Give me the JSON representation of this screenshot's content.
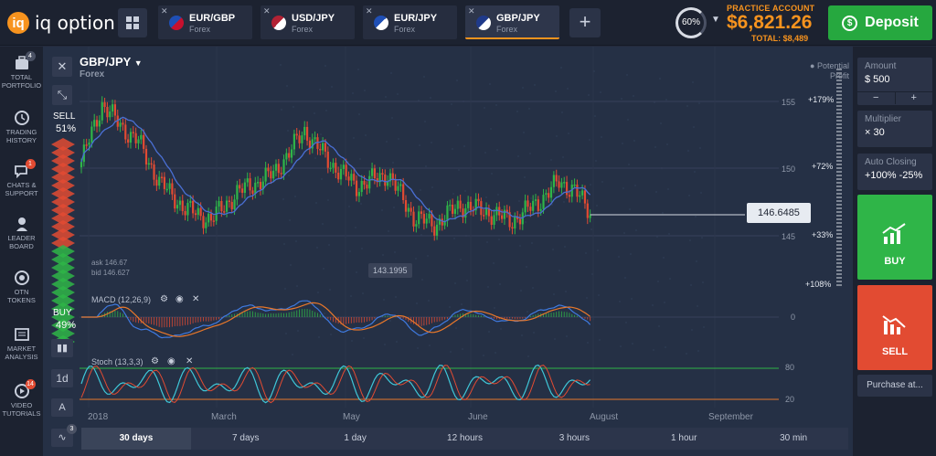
{
  "brand": {
    "name": "iq option",
    "mark": "iq"
  },
  "tabs": [
    {
      "pair": "EUR/GBP",
      "type": "Forex",
      "active": false,
      "flag_colors": [
        "#1f4fb5",
        "#c8102e"
      ]
    },
    {
      "pair": "USD/JPY",
      "type": "Forex",
      "active": false,
      "flag_colors": [
        "#b22234",
        "#ffffff"
      ]
    },
    {
      "pair": "EUR/JPY",
      "type": "Forex",
      "active": false,
      "flag_colors": [
        "#1f4fb5",
        "#ffffff"
      ]
    },
    {
      "pair": "GBP/JPY",
      "type": "Forex",
      "active": true,
      "flag_colors": [
        "#1f3a8a",
        "#ffffff"
      ]
    }
  ],
  "header": {
    "add_tab": "+",
    "progress_label": "60%",
    "progress": 0.6,
    "account_label": "PRACTICE ACCOUNT",
    "balance": "$6,821.26",
    "total": "TOTAL: $8,489",
    "deposit_label": "Deposit"
  },
  "sidebar": [
    {
      "label": "TOTAL PORTFOLIO",
      "icon": "briefcase-icon",
      "badge": "4",
      "badge_color": "#4a5164"
    },
    {
      "label": "TRADING HISTORY",
      "icon": "clock-icon",
      "badge": "",
      "badge_color": ""
    },
    {
      "label": "CHATS & SUPPORT",
      "icon": "chat-icon",
      "badge": "1",
      "badge_color": "#e24b32"
    },
    {
      "label": "LEADER BOARD",
      "icon": "leaderboard-icon",
      "badge": "",
      "badge_color": ""
    },
    {
      "label": "OTN TOKENS",
      "icon": "token-icon",
      "badge": "",
      "badge_color": ""
    },
    {
      "label": "MARKET ANALYSIS",
      "icon": "analysis-icon",
      "badge": "",
      "badge_color": ""
    },
    {
      "label": "VIDEO TUTORIALS",
      "icon": "video-icon",
      "badge": "14",
      "badge_color": "#e24b32"
    }
  ],
  "asset": {
    "name": "GBP/JPY",
    "type": "Forex"
  },
  "potential_profit": [
    "Potential",
    "Profit"
  ],
  "sentiment": {
    "sell_label": "SELL",
    "sell_pct": "51%",
    "buy_label": "BUY",
    "buy_pct": "49%",
    "sell": 51,
    "buy": 49
  },
  "price_now": "146.6485",
  "low_tag": "143.1995",
  "ask": "ask 146.67",
  "bid": "bid 146.627",
  "y_axis": [
    "155",
    "150",
    "145"
  ],
  "profit_levels": [
    "+179%",
    "+72%",
    "+33%",
    "+108%"
  ],
  "indicators": {
    "macd": {
      "label": "MACD (12,26,9)",
      "zero": "0"
    },
    "stoch": {
      "label": "Stoch (13,3,3)",
      "upper": "80",
      "lower": "20"
    }
  },
  "months": [
    "2018",
    "March",
    "May",
    "June",
    "August",
    "September"
  ],
  "timeframes": [
    "30 days",
    "7 days",
    "1 day",
    "12 hours",
    "3 hours",
    "1 hour",
    "30 min"
  ],
  "side_tools": {
    "period": "1d",
    "count_badge": "3"
  },
  "right_panel": {
    "amount_label": "Amount",
    "amount_value": "$  500",
    "minus": "−",
    "plus": "+",
    "multiplier_label": "Multiplier",
    "multiplier_value": "× 30",
    "auto_label": "Auto Closing",
    "auto_value": "+100% -25%",
    "buy_label": "BUY",
    "sell_label": "SELL",
    "purchase_label": "Purchase at..."
  },
  "colors": {
    "accent": "#f7931e",
    "up": "#2fb548",
    "down": "#e24b32",
    "ma": "#4a6fd4",
    "orange_line": "#e8772a",
    "stoch_cyan": "#3fc7d8"
  }
}
